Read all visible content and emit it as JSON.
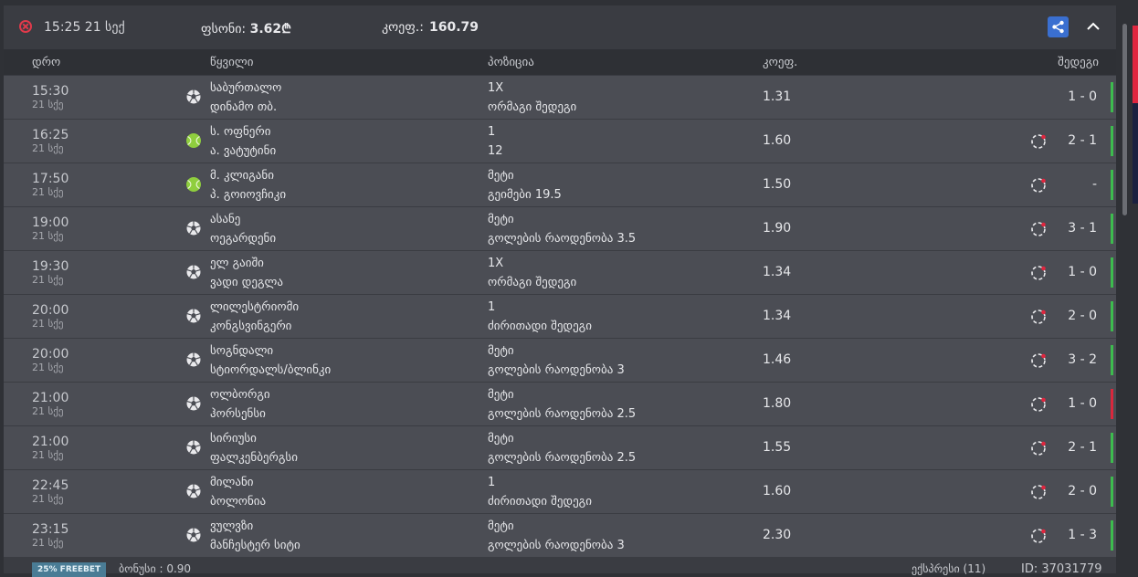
{
  "top": {
    "time": "15:25 21 სექ",
    "price_label": "ფსონი:",
    "price_value": "3.62₾",
    "odds_label": "კოეფ.:",
    "odds_value": "160.79"
  },
  "headers": {
    "date": "დრო",
    "match": "წყვილი",
    "position": "პოზიცია",
    "odds": "კოეფ.",
    "results": "შედეგი"
  },
  "rows": [
    {
      "time": "15:30",
      "date": "21 სქე",
      "sport": "football",
      "team1": "საბურთალო",
      "team2": "დინამო თბ.",
      "pick": "1X",
      "market": "ორმაგი შედეგი",
      "odd": "1.31",
      "score": "1 - 0",
      "live": false,
      "result_color": "#3dbb4e"
    },
    {
      "time": "16:25",
      "date": "21 სქე",
      "sport": "tennis",
      "team1": "ს. ოფნერი",
      "team2": "ა. ვატუტინი",
      "pick": "1",
      "market": "12",
      "odd": "1.60",
      "score": "2 - 1",
      "live": true,
      "result_color": "#3dbb4e"
    },
    {
      "time": "17:50",
      "date": "21 სქე",
      "sport": "tennis",
      "team1": "მ. კლიგანი",
      "team2": "პ. გოიოვჩიკი",
      "pick": "მეტი",
      "market": "გეიმები 19.5",
      "odd": "1.50",
      "score": "-",
      "live": true,
      "result_color": "#3dbb4e"
    },
    {
      "time": "19:00",
      "date": "21 სქე",
      "sport": "football",
      "team1": "ასანე",
      "team2": "ოეგარდენი",
      "pick": "მეტი",
      "market": "გოლების რაოდენობა 3.5",
      "odd": "1.90",
      "score": "3 - 1",
      "live": true,
      "result_color": "#3dbb4e"
    },
    {
      "time": "19:30",
      "date": "21 სქე",
      "sport": "football",
      "team1": "ელ გაიში",
      "team2": "ვადი დეგლა",
      "pick": "1X",
      "market": "ორმაგი შედეგი",
      "odd": "1.34",
      "score": "1 - 0",
      "live": true,
      "result_color": "#3dbb4e"
    },
    {
      "time": "20:00",
      "date": "21 სქე",
      "sport": "football",
      "team1": "ლილესტრიომი",
      "team2": "კონგსვინგერი",
      "pick": "1",
      "market": "ძირითადი შედეგი",
      "odd": "1.34",
      "score": "2 - 0",
      "live": true,
      "result_color": "#3dbb4e"
    },
    {
      "time": "20:00",
      "date": "21 სქე",
      "sport": "football",
      "team1": "სოგნდალი",
      "team2": "სტიორდალს/ბლინკი",
      "pick": "მეტი",
      "market": "გოლების რაოდენობა 3",
      "odd": "1.46",
      "score": "3 - 2",
      "live": true,
      "result_color": "#3dbb4e"
    },
    {
      "time": "21:00",
      "date": "21 სქე",
      "sport": "football",
      "team1": "ოლბორგი",
      "team2": "ჰორსენსი",
      "pick": "მეტი",
      "market": "გოლების რაოდენობა 2.5",
      "odd": "1.80",
      "score": "1 - 0",
      "live": true,
      "result_color": "#d9283d"
    },
    {
      "time": "21:00",
      "date": "21 სქე",
      "sport": "football",
      "team1": "სირიუსი",
      "team2": "ფალკენბერგსი",
      "pick": "მეტი",
      "market": "გოლების რაოდენობა 2.5",
      "odd": "1.55",
      "score": "2 - 1",
      "live": true,
      "result_color": "#3dbb4e"
    },
    {
      "time": "22:45",
      "date": "21 სქე",
      "sport": "football",
      "team1": "მილანი",
      "team2": "ბოლონია",
      "pick": "1",
      "market": "ძირითადი შედეგი",
      "odd": "1.60",
      "score": "2 - 0",
      "live": true,
      "result_color": "#3dbb4e"
    },
    {
      "time": "23:15",
      "date": "21 სქე",
      "sport": "football",
      "team1": "ვულვზი",
      "team2": "მანჩესტერ სიტი",
      "pick": "მეტი",
      "market": "გოლების რაოდენობა 3",
      "odd": "2.30",
      "score": "1 - 3",
      "live": true,
      "result_color": "#3dbb4e"
    }
  ],
  "footer": {
    "freebet": "25% FREEBET",
    "bonus": "ბონუსი : 0.90",
    "express": "ექსპრესი (11)",
    "id": "ID: 37031779"
  },
  "icons": {
    "status": "close-circle-icon",
    "share": "share-icon",
    "collapse": "chevron-up-icon",
    "football": "football-icon",
    "tennis": "tennis-ball-icon",
    "live": "live-refresh-icon"
  }
}
